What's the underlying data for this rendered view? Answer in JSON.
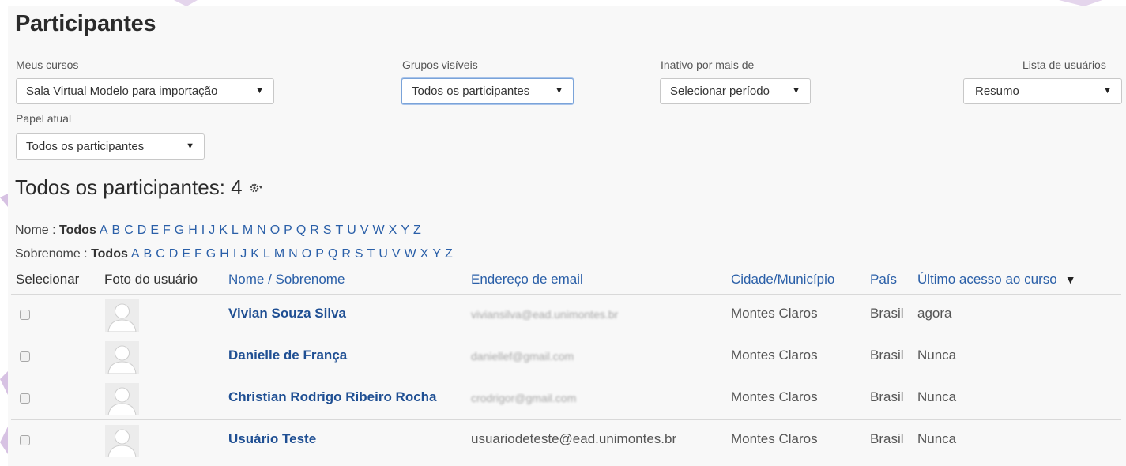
{
  "page": {
    "title": "Participantes"
  },
  "filters": {
    "meus_cursos": {
      "label": "Meus cursos",
      "value": "Sala Virtual Modelo para importação"
    },
    "grupos": {
      "label": "Grupos visíveis",
      "value": "Todos os participantes"
    },
    "inativo": {
      "label": "Inativo por mais de",
      "value": "Selecionar período"
    },
    "lista": {
      "label": "Lista de usuários",
      "value": "Resumo"
    },
    "papel": {
      "label": "Papel atual",
      "value": "Todos os participantes"
    }
  },
  "participants_heading": "Todos os participantes: 4",
  "initials": {
    "first_label": "Nome :",
    "last_label": "Sobrenome :",
    "all": "Todos",
    "letters": [
      "A",
      "B",
      "C",
      "D",
      "E",
      "F",
      "G",
      "H",
      "I",
      "J",
      "K",
      "L",
      "M",
      "N",
      "O",
      "P",
      "Q",
      "R",
      "S",
      "T",
      "U",
      "V",
      "W",
      "X",
      "Y",
      "Z"
    ]
  },
  "table": {
    "headers": {
      "select": "Selecionar",
      "photo": "Foto do usuário",
      "name": "Nome / Sobrenome",
      "email": "Endereço de email",
      "city": "Cidade/Município",
      "country": "País",
      "last_access": "Último acesso ao curso"
    },
    "rows": [
      {
        "name": "Vivian Souza Silva",
        "email": "viviansilva@ead.unimontes.br",
        "email_blurred": true,
        "city": "Montes Claros",
        "country": "Brasil",
        "last_access": "agora"
      },
      {
        "name": "Danielle de França",
        "email": "daniellef@gmail.com",
        "email_blurred": true,
        "city": "Montes Claros",
        "country": "Brasil",
        "last_access": "Nunca"
      },
      {
        "name": "Christian Rodrigo Ribeiro Rocha",
        "email": "crodrigor@gmail.com",
        "email_blurred": true,
        "city": "Montes Claros",
        "country": "Brasil",
        "last_access": "Nunca"
      },
      {
        "name": "Usuário Teste",
        "email": "usuariodeteste@ead.unimontes.br",
        "email_blurred": false,
        "city": "Montes Claros",
        "country": "Brasil",
        "last_access": "Nunca"
      }
    ]
  },
  "icons": {
    "gear": "gear-icon",
    "caret": "caret-down-icon",
    "sort": "sort-desc-icon",
    "avatar": "user-avatar-icon"
  },
  "colors": {
    "link": "#2a5fa8",
    "name_link": "#1f4f93",
    "panel": "#f8f8f8",
    "deco": "#d7c2e3"
  }
}
